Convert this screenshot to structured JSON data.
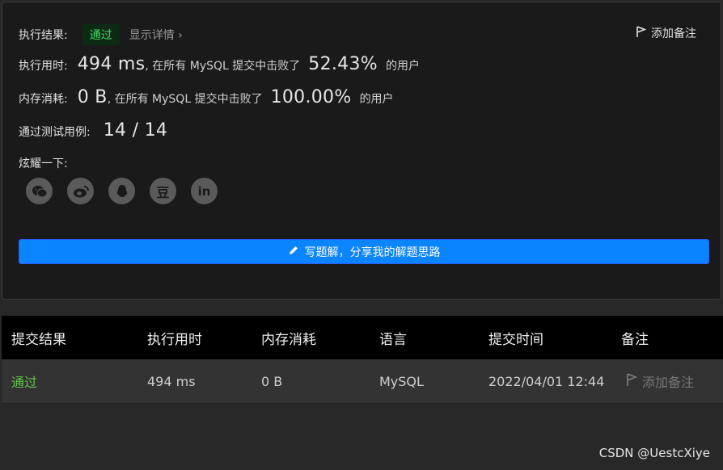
{
  "result": {
    "label": "执行结果:",
    "status": "通过",
    "details_link": "显示详情",
    "details_chevron": "›",
    "add_note": "添加备注"
  },
  "runtime": {
    "label": "执行用时:",
    "value": "494 ms",
    "mid_text": ", 在所有 MySQL 提交中击败了",
    "percent": "52.43%",
    "suffix": "的用户"
  },
  "memory": {
    "label": "内存消耗:",
    "value": "0 B",
    "mid_text": ", 在所有 MySQL 提交中击败了",
    "percent": "100.00%",
    "suffix": "的用户"
  },
  "tests": {
    "label": "通过测试用例:",
    "value": "14 / 14"
  },
  "share": {
    "label": "炫耀一下:",
    "icons": [
      "wechat-icon",
      "weibo-icon",
      "qq-icon",
      "douban-icon",
      "linkedin-icon"
    ],
    "douban_glyph": "豆",
    "linkedin_glyph": "in"
  },
  "write_button": {
    "label": "写题解，分享我的解题思路"
  },
  "table": {
    "headers": [
      "提交结果",
      "执行用时",
      "内存消耗",
      "语言",
      "提交时间",
      "备注"
    ],
    "rows": [
      {
        "status": "通过",
        "runtime": "494 ms",
        "memory": "0 B",
        "language": "MySQL",
        "time": "2022/04/01 12:44",
        "note": "添加备注"
      }
    ]
  },
  "watermark": "CSDN @UestcXiye",
  "colors": {
    "accent": "#0a84ff",
    "pass": "#5ec44a",
    "badge_bg": "#0d2a12"
  }
}
